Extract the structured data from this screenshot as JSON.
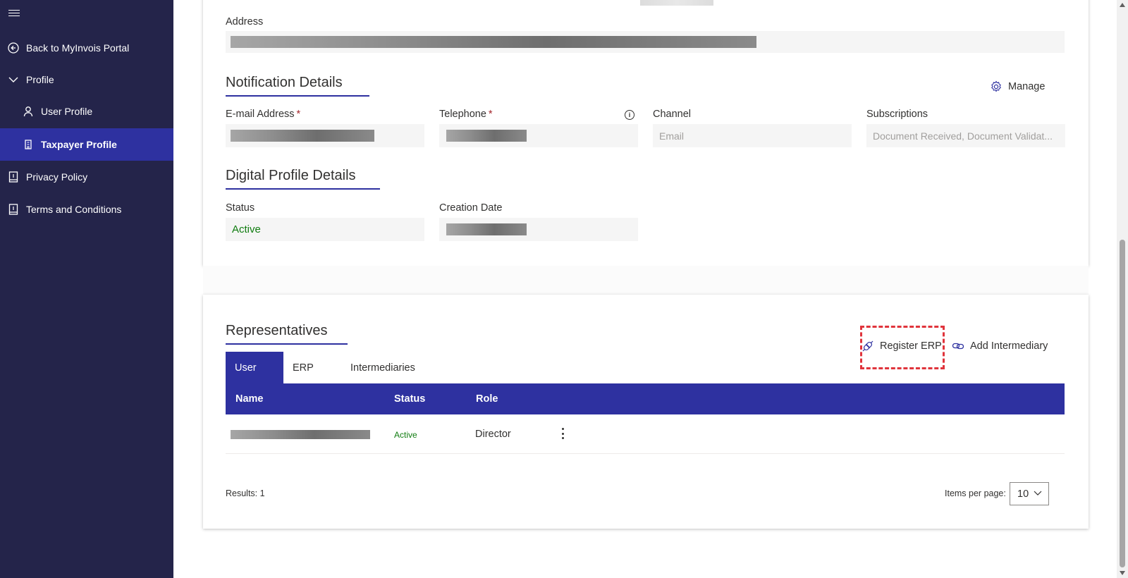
{
  "sidebar": {
    "items": [
      {
        "label": "Back to MyInvois Portal",
        "icon": "arrow-left-circle-icon"
      },
      {
        "label": "Profile",
        "icon": "chevron-down-icon"
      },
      {
        "label": "User Profile",
        "icon": "person-icon"
      },
      {
        "label": "Taxpayer Profile",
        "icon": "building-icon"
      },
      {
        "label": "Privacy Policy",
        "icon": "book-icon"
      },
      {
        "label": "Terms and Conditions",
        "icon": "book-icon"
      }
    ]
  },
  "address": {
    "label": "Address"
  },
  "notification": {
    "title": "Notification Details",
    "manage_label": "Manage",
    "email_label": "E-mail Address",
    "telephone_label": "Telephone",
    "required_mark": "*",
    "channel_label": "Channel",
    "channel_value": "Email",
    "subscriptions_label": "Subscriptions",
    "subscriptions_value": "Document Received, Document Validat..."
  },
  "digital_profile": {
    "title": "Digital Profile Details",
    "status_label": "Status",
    "status_value": "Active",
    "creation_date_label": "Creation Date"
  },
  "representatives": {
    "title": "Representatives",
    "register_erp_label": "Register ERP",
    "add_intermediary_label": "Add Intermediary",
    "tabs": [
      "User",
      "ERP",
      "Intermediaries"
    ],
    "columns": [
      "Name",
      "Status",
      "Role"
    ],
    "rows": [
      {
        "status": "Active",
        "role": "Director"
      }
    ],
    "results_label": "Results: 1",
    "items_per_page_label": "Items per page:",
    "items_per_page_value": "10"
  },
  "colors": {
    "sidebar_bg": "#24244a",
    "accent": "#2e31a0",
    "active_green": "#107c10",
    "required_red": "#a4262c",
    "highlight_red": "#e0343c"
  }
}
